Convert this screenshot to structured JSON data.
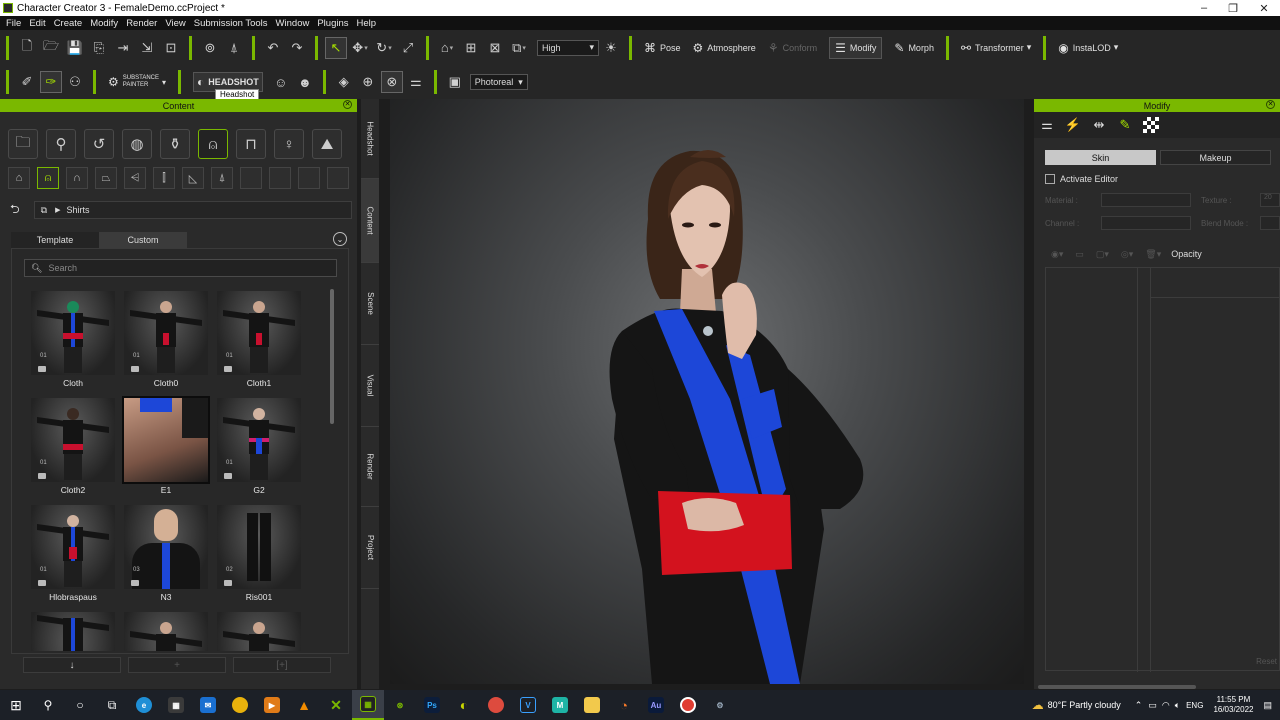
{
  "window": {
    "title": "Character Creator 3 - FemaleDemo.ccProject *"
  },
  "menu": [
    "File",
    "Edit",
    "Create",
    "Modify",
    "Render",
    "View",
    "Submission Tools",
    "Window",
    "Plugins",
    "Help"
  ],
  "toolbar1": {
    "quality": "High",
    "pose": "Pose",
    "atmosphere": "Atmosphere",
    "conform": "Conform",
    "modify": "Modify",
    "morph": "Morph",
    "transformer": "Transformer",
    "instalod": "InstaLOD"
  },
  "toolbar2": {
    "substance_line1": "SUBSTANCE",
    "substance_line2": "PAINTER",
    "headshot": "HEADSHOT",
    "render_mode": "Photoreal",
    "tooltip": "Headshot"
  },
  "content_panel": {
    "title": "Content",
    "path": "Shirts",
    "tabs": [
      "Template",
      "Custom"
    ],
    "active_tab": "Custom",
    "search_placeholder": "Search",
    "items": [
      {
        "label": "Cloth",
        "badge": "01"
      },
      {
        "label": "Cloth0",
        "badge": "01"
      },
      {
        "label": "Cloth1",
        "badge": "01"
      },
      {
        "label": "Cloth2",
        "badge": "01"
      },
      {
        "label": "E1",
        "badge": ""
      },
      {
        "label": "G2",
        "badge": "01"
      },
      {
        "label": "Hlobraspaus",
        "badge": "01"
      },
      {
        "label": "N3",
        "badge": "03"
      },
      {
        "label": "Ris001",
        "badge": "02"
      },
      {
        "label": "",
        "badge": ""
      },
      {
        "label": "",
        "badge": ""
      },
      {
        "label": "",
        "badge": ""
      }
    ],
    "bottom_buttons": [
      "↓",
      "+",
      "[+]"
    ]
  },
  "side_tabs": [
    "Headshot",
    "Content",
    "Scene",
    "Visual",
    "Render",
    "Project"
  ],
  "modify_panel": {
    "title": "Modify",
    "tabs": [
      "Skin",
      "Makeup"
    ],
    "activate_editor": "Activate Editor",
    "material_label": "Material :",
    "texture_label": "Texture :",
    "texture_value": "20",
    "channel_label": "Channel :",
    "blend_label": "Blend Mode :",
    "opacity": "Opacity",
    "reset": "Reset"
  },
  "taskbar": {
    "weather": "80°F  Partly cloudy",
    "lang": "ENG",
    "time": "11:55 PM",
    "date": "16/03/2022"
  },
  "colors": {
    "accent": "#7ab800",
    "panel": "#2a2a2a",
    "toolbar": "#262626"
  }
}
